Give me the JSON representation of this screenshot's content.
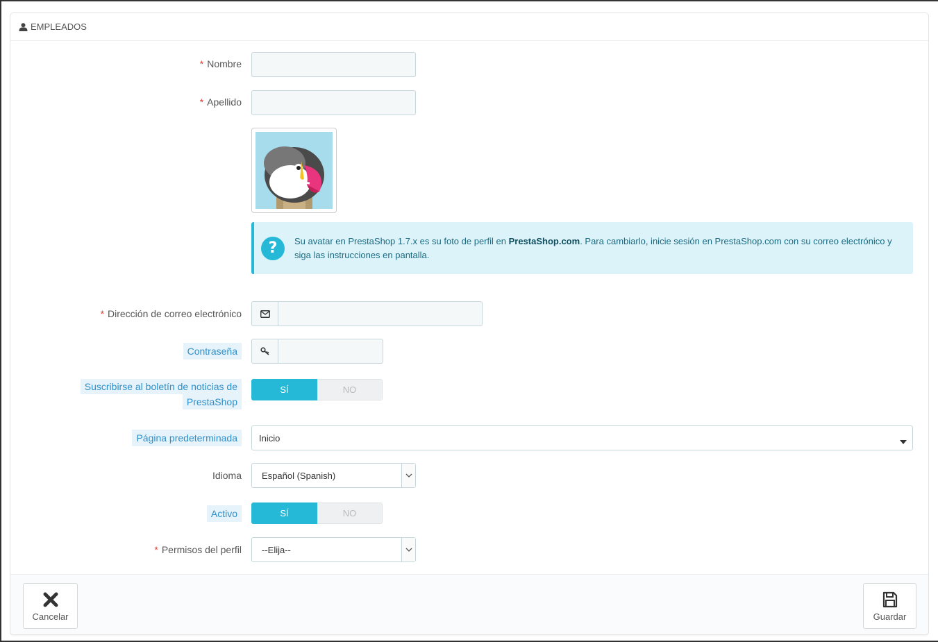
{
  "panel": {
    "title": "EMPLEADOS"
  },
  "fields": {
    "first_name": {
      "label": "Nombre",
      "required_mark": "*",
      "value": ""
    },
    "last_name": {
      "label": "Apellido",
      "required_mark": "*",
      "value": ""
    },
    "email": {
      "label": "Dirección de correo electrónico",
      "required_mark": "*",
      "value": ""
    },
    "password": {
      "label": "Contraseña",
      "value": ""
    },
    "newsletter": {
      "label_line1": "Suscribirse al boletín de noticias de",
      "label_line2": "PrestaShop",
      "on": "SÍ",
      "off": "NO",
      "selected": "SÍ"
    },
    "default_page": {
      "label": "Página predeterminada",
      "value": "Inicio"
    },
    "language": {
      "label": "Idioma",
      "value": "Español (Spanish)"
    },
    "active": {
      "label": "Activo",
      "on": "SÍ",
      "off": "NO",
      "selected": "SÍ"
    },
    "profile": {
      "label": "Permisos del perfil",
      "required_mark": "*",
      "value": "--Elija--"
    }
  },
  "info": {
    "text_before": "Su avatar en PrestaShop 1.7.x es su foto de perfil en ",
    "bold": "PrestaShop.com",
    "text_after": ". Para cambiarlo, inicie sesión en PrestaShop.com con su correo electrónico y siga las instrucciones en pantalla.",
    "icon": "question-circle-icon"
  },
  "footer": {
    "cancel_label": "Cancelar",
    "save_label": "Guardar"
  },
  "colors": {
    "accent": "#25b9d7",
    "required": "#e03c31",
    "hint_label": "#2e8fc9",
    "info_bg": "#dcf4f9"
  }
}
